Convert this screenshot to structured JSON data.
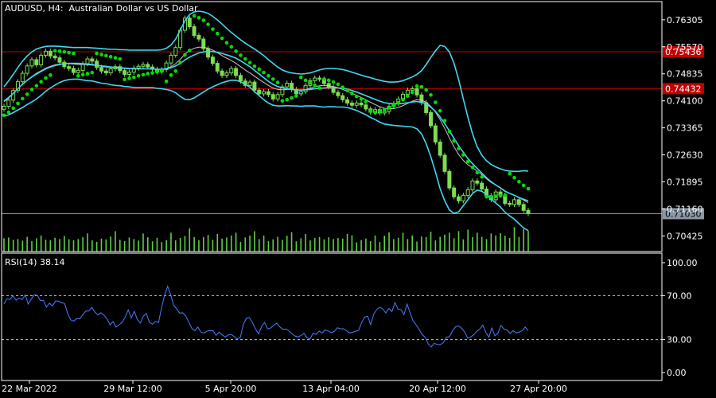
{
  "header": {
    "symbol_title": "AUDUSD, H4:  Australian Dollar vs US Dollar"
  },
  "rsi_panel": {
    "title": "RSI(14) 38.14"
  },
  "colors": {
    "background": "#000000",
    "candle": "#7fdc55",
    "volume": "#5fcf45",
    "bollinger": "#40d8f0",
    "moving_average": "#c8c8c8",
    "parabolic_sar": "#00e000",
    "hline": "#c00000",
    "bid_line": "#8a98a6",
    "rsi_line": "#4a7cff",
    "axis_text": "#ffffff"
  },
  "chart_data": [
    {
      "type": "candlestick",
      "title": "AUDUSD, H4:  Australian Dollar vs US Dollar",
      "ylim": [
        0.7,
        0.768
      ],
      "y_tick_labels": [
        "0.76305",
        "0.75570",
        "0.74835",
        "0.74100",
        "0.73365",
        "0.72630",
        "0.71895",
        "0.71160",
        "0.70425"
      ],
      "y_ticks": [
        0.76305,
        0.7557,
        0.74835,
        0.741,
        0.73365,
        0.7263,
        0.71895,
        0.7116,
        0.70425
      ],
      "horizontal_levels": [
        {
          "value": 0.75436,
          "label": "0.75436",
          "color": "#c00000"
        },
        {
          "value": 0.74432,
          "label": "0.74432",
          "color": "#c00000"
        }
      ],
      "current_price": {
        "value": 0.7103,
        "label": "0.71030"
      },
      "x_labels": [
        "22 Mar 2022",
        "29 Mar 12:00",
        "5 Apr 20:00",
        "13 Apr 04:00",
        "20 Apr 12:00",
        "27 Apr 20:00"
      ],
      "close": [
        0.7395,
        0.7412,
        0.7438,
        0.7462,
        0.7485,
        0.7505,
        0.7522,
        0.7508,
        0.7534,
        0.7545,
        0.7532,
        0.7527,
        0.7515,
        0.7503,
        0.7498,
        0.7487,
        0.7493,
        0.7511,
        0.7524,
        0.7518,
        0.7501,
        0.7491,
        0.7486,
        0.7497,
        0.7503,
        0.7492,
        0.7482,
        0.7488,
        0.7499,
        0.7504,
        0.7509,
        0.7502,
        0.7496,
        0.7489,
        0.7495,
        0.7513,
        0.7534,
        0.7555,
        0.7602,
        0.7635,
        0.7612,
        0.7588,
        0.7578,
        0.7552,
        0.7529,
        0.7512,
        0.7491,
        0.7479,
        0.7486,
        0.7498,
        0.7479,
        0.7464,
        0.7452,
        0.7461,
        0.7439,
        0.7429,
        0.7435,
        0.7427,
        0.7415,
        0.7427,
        0.7448,
        0.7458,
        0.7441,
        0.7429,
        0.7435,
        0.7452,
        0.7465,
        0.7472,
        0.7469,
        0.7457,
        0.7448,
        0.7433,
        0.7424,
        0.7413,
        0.7404,
        0.7398,
        0.7404,
        0.7399,
        0.7388,
        0.7379,
        0.7386,
        0.7377,
        0.7381,
        0.7395,
        0.7403,
        0.7415,
        0.7428,
        0.7439,
        0.7443,
        0.7426,
        0.7405,
        0.7378,
        0.7342,
        0.7298,
        0.7262,
        0.7218,
        0.7173,
        0.7149,
        0.7138,
        0.7153,
        0.7168,
        0.7192,
        0.7186,
        0.717,
        0.7152,
        0.7141,
        0.7162,
        0.7153,
        0.7131,
        0.7128,
        0.7141,
        0.7128,
        0.7112,
        0.7103
      ],
      "bollinger_mid": [
        0.7408,
        0.7418,
        0.743,
        0.7443,
        0.7455,
        0.7466,
        0.7475,
        0.7483,
        0.749,
        0.7497,
        0.7502,
        0.7506,
        0.7509,
        0.7511,
        0.7512,
        0.7512,
        0.7512,
        0.7511,
        0.751,
        0.7509,
        0.7507,
        0.7505,
        0.7504,
        0.7502,
        0.7501,
        0.75,
        0.7499,
        0.7498,
        0.7497,
        0.7497,
        0.7497,
        0.7497,
        0.7497,
        0.7496,
        0.7496,
        0.7497,
        0.75,
        0.7505,
        0.7512,
        0.7521,
        0.7529,
        0.7535,
        0.754,
        0.7543,
        0.7545,
        0.7544,
        0.7542,
        0.7539,
        0.7535,
        0.7531,
        0.7526,
        0.7519,
        0.7511,
        0.7503,
        0.7493,
        0.7483,
        0.7473,
        0.7463,
        0.7455,
        0.7449,
        0.7445,
        0.7443,
        0.7441,
        0.744,
        0.7439,
        0.744,
        0.7441,
        0.7443,
        0.7444,
        0.7445,
        0.7446,
        0.7446,
        0.7445,
        0.7444,
        0.7442,
        0.7438,
        0.7434,
        0.7429,
        0.7424,
        0.7419,
        0.7414,
        0.7409,
        0.7405,
        0.7403,
        0.7402,
        0.7402,
        0.7403,
        0.7405,
        0.7407,
        0.7408,
        0.7406,
        0.7401,
        0.7393,
        0.7381,
        0.7366,
        0.7348,
        0.7328,
        0.7308,
        0.7288,
        0.727,
        0.7253,
        0.7239,
        0.7226,
        0.7213,
        0.7201,
        0.719,
        0.7181,
        0.7173,
        0.7164,
        0.7158,
        0.7153,
        0.7147,
        0.7142,
        0.7138
      ],
      "bollinger_upper": [
        0.7448,
        0.7464,
        0.7482,
        0.7501,
        0.7518,
        0.7532,
        0.7543,
        0.7551,
        0.7555,
        0.7558,
        0.7559,
        0.7559,
        0.7558,
        0.7557,
        0.7556,
        0.7555,
        0.7555,
        0.7555,
        0.7555,
        0.7554,
        0.7553,
        0.7552,
        0.7551,
        0.755,
        0.755,
        0.7549,
        0.7549,
        0.7548,
        0.7548,
        0.7548,
        0.7548,
        0.7548,
        0.7548,
        0.7548,
        0.7549,
        0.7553,
        0.7562,
        0.7578,
        0.7602,
        0.7628,
        0.7645,
        0.7652,
        0.7654,
        0.7652,
        0.7648,
        0.764,
        0.763,
        0.7619,
        0.7607,
        0.7596,
        0.7586,
        0.7576,
        0.7567,
        0.7559,
        0.7551,
        0.7542,
        0.7533,
        0.7522,
        0.7512,
        0.7502,
        0.7494,
        0.7489,
        0.7486,
        0.7484,
        0.7483,
        0.7484,
        0.7486,
        0.749,
        0.7494,
        0.7497,
        0.7498,
        0.7498,
        0.7497,
        0.7495,
        0.7492,
        0.7488,
        0.7484,
        0.748,
        0.7476,
        0.7473,
        0.7469,
        0.7466,
        0.7463,
        0.7461,
        0.7461,
        0.7462,
        0.7465,
        0.747,
        0.7475,
        0.7482,
        0.7492,
        0.7509,
        0.7528,
        0.7546,
        0.7561,
        0.7558,
        0.7543,
        0.7512,
        0.7468,
        0.7415,
        0.7365,
        0.732,
        0.7285,
        0.7262,
        0.7247,
        0.7237,
        0.723,
        0.7225,
        0.7221,
        0.7219,
        0.7218,
        0.7218,
        0.722,
        0.7219
      ],
      "bollinger_lower": [
        0.7368,
        0.7372,
        0.7378,
        0.7385,
        0.7392,
        0.74,
        0.7407,
        0.7415,
        0.7425,
        0.7436,
        0.7445,
        0.7453,
        0.746,
        0.7465,
        0.7468,
        0.7469,
        0.7469,
        0.7467,
        0.7465,
        0.7464,
        0.7461,
        0.7458,
        0.7457,
        0.7454,
        0.7452,
        0.7451,
        0.7449,
        0.7448,
        0.7446,
        0.7446,
        0.7446,
        0.7446,
        0.7446,
        0.7444,
        0.7443,
        0.7441,
        0.7438,
        0.7432,
        0.7422,
        0.7414,
        0.7413,
        0.7418,
        0.7426,
        0.7434,
        0.7442,
        0.7448,
        0.7454,
        0.7459,
        0.7463,
        0.7466,
        0.7466,
        0.7462,
        0.7455,
        0.7447,
        0.7435,
        0.7424,
        0.7413,
        0.7404,
        0.7398,
        0.7396,
        0.7396,
        0.7397,
        0.7396,
        0.7396,
        0.7395,
        0.7396,
        0.7396,
        0.7396,
        0.7394,
        0.7393,
        0.7394,
        0.7394,
        0.7393,
        0.7393,
        0.7392,
        0.7388,
        0.7384,
        0.7378,
        0.7372,
        0.7365,
        0.7359,
        0.7352,
        0.7347,
        0.7345,
        0.7343,
        0.7342,
        0.7341,
        0.734,
        0.7339,
        0.7334,
        0.732,
        0.7293,
        0.7258,
        0.7216,
        0.7171,
        0.7138,
        0.7113,
        0.7104,
        0.7108,
        0.7125,
        0.7141,
        0.7158,
        0.7167,
        0.7164,
        0.7155,
        0.7143,
        0.7132,
        0.7121,
        0.7107,
        0.7097,
        0.7088,
        0.7076,
        0.7064,
        0.7057
      ],
      "moving_average": [
        0.741,
        0.742,
        0.7431,
        0.7443,
        0.7455,
        0.7466,
        0.7476,
        0.7485,
        0.7492,
        0.7499,
        0.7504,
        0.7508,
        0.751,
        0.7511,
        0.7511,
        0.751,
        0.7509,
        0.7509,
        0.7508,
        0.7507,
        0.7506,
        0.7504,
        0.7502,
        0.7501,
        0.75,
        0.7499,
        0.7498,
        0.7497,
        0.7497,
        0.7497,
        0.7497,
        0.7497,
        0.7496,
        0.7496,
        0.7496,
        0.7498,
        0.7503,
        0.7511,
        0.7523,
        0.7537,
        0.7547,
        0.7553,
        0.7556,
        0.7556,
        0.7553,
        0.7548,
        0.7541,
        0.7533,
        0.7526,
        0.752,
        0.7512,
        0.7503,
        0.7494,
        0.7486,
        0.7477,
        0.7468,
        0.746,
        0.7452,
        0.7445,
        0.7441,
        0.744,
        0.7441,
        0.7441,
        0.744,
        0.7439,
        0.7441,
        0.7444,
        0.7448,
        0.7451,
        0.7452,
        0.7451,
        0.7449,
        0.7446,
        0.7441,
        0.7436,
        0.743,
        0.7425,
        0.7419,
        0.7413,
        0.7406,
        0.74,
        0.7394,
        0.739,
        0.7388,
        0.7389,
        0.7392,
        0.7397,
        0.7403,
        0.7409,
        0.7413,
        0.7412,
        0.7406,
        0.7395,
        0.7379,
        0.7359,
        0.7335,
        0.7309,
        0.7285,
        0.7264,
        0.7248,
        0.7236,
        0.7228,
        0.7219,
        0.7209,
        0.7198,
        0.7188,
        0.7181,
        0.7174,
        0.7165,
        0.7158,
        0.7153,
        0.7147,
        0.714,
        0.7133
      ],
      "parabolic_sar": [
        0.7371,
        0.7379,
        0.739,
        0.7403,
        0.7416,
        0.7428,
        0.7441,
        0.7451,
        0.7462,
        0.7472,
        0.748,
        0.7546,
        0.7545,
        0.7543,
        0.7541,
        0.7539,
        0.7478,
        0.7481,
        0.7484,
        0.7487,
        0.7539,
        0.7536,
        0.7533,
        0.753,
        0.7527,
        0.7524,
        0.7468,
        0.7471,
        0.7474,
        0.7478,
        0.7481,
        0.7484,
        0.7486,
        0.7489,
        0.7491,
        0.7463,
        0.748,
        0.7491,
        0.7514,
        0.7535,
        0.7547,
        0.7641,
        0.7636,
        0.7629,
        0.7618,
        0.7605,
        0.7593,
        0.758,
        0.7568,
        0.7557,
        0.7545,
        0.7534,
        0.7524,
        0.7514,
        0.7504,
        0.7496,
        0.7487,
        0.7478,
        0.7469,
        0.746,
        0.741,
        0.7413,
        0.7418,
        0.7423,
        0.7474,
        0.7466,
        0.7459,
        0.7452,
        0.7445,
        0.7469,
        0.7466,
        0.7461,
        0.7455,
        0.7447,
        0.7438,
        0.743,
        0.7422,
        0.7415,
        0.7408,
        0.7382,
        0.7378,
        0.7381,
        0.7386,
        0.7391,
        0.7398,
        0.7405,
        0.7413,
        0.7423,
        0.7433,
        0.745,
        0.7448,
        0.744,
        0.7426,
        0.7406,
        0.7383,
        0.7356,
        0.7327,
        0.7301,
        0.728,
        0.7263,
        0.7245,
        0.7229,
        0.7215,
        0.7203,
        0.7149,
        0.7149,
        0.715,
        0.7152,
        0.7153,
        0.7212,
        0.7201,
        0.719,
        0.718,
        0.7171
      ],
      "volume": [
        0.52,
        0.55,
        0.46,
        0.49,
        0.43,
        0.58,
        0.41,
        0.52,
        0.63,
        0.47,
        0.45,
        0.54,
        0.49,
        0.61,
        0.48,
        0.45,
        0.49,
        0.56,
        0.71,
        0.44,
        0.38,
        0.51,
        0.48,
        0.59,
        0.8,
        0.46,
        0.41,
        0.55,
        0.49,
        0.43,
        0.71,
        0.56,
        0.4,
        0.54,
        0.37,
        0.45,
        0.74,
        0.44,
        0.53,
        0.61,
        0.91,
        0.57,
        0.45,
        0.57,
        0.65,
        0.46,
        0.69,
        0.51,
        0.55,
        0.63,
        0.74,
        0.38,
        0.55,
        0.63,
        0.8,
        0.49,
        0.63,
        0.41,
        0.48,
        0.58,
        0.46,
        0.62,
        0.76,
        0.4,
        0.52,
        0.69,
        0.44,
        0.53,
        0.57,
        0.48,
        0.56,
        0.49,
        0.53,
        0.51,
        0.69,
        0.64,
        0.36,
        0.45,
        0.51,
        0.41,
        0.63,
        0.37,
        0.62,
        0.75,
        0.49,
        0.54,
        0.74,
        0.49,
        0.63,
        0.39,
        0.59,
        0.57,
        0.78,
        0.44,
        0.58,
        0.66,
        0.74,
        0.52,
        0.8,
        0.48,
        0.86,
        0.57,
        0.74,
        0.58,
        0.49,
        0.71,
        0.63,
        0.72,
        0.62,
        0.53,
        0.96,
        0.57,
        0.88,
        0.81
      ]
    },
    {
      "type": "line",
      "title": "RSI(14) 38.14",
      "ylim": [
        0,
        100
      ],
      "y_tick_labels": [
        "100.00",
        "70.00",
        "30.00",
        "0.00"
      ],
      "y_ticks": [
        100,
        70,
        30,
        0
      ],
      "levels": [
        70,
        30
      ],
      "x_labels": [
        "22 Mar 2022",
        "29 Mar 12:00",
        "5 Apr 20:00",
        "13 Apr 04:00",
        "20 Apr 12:00",
        "27 Apr 20:00"
      ],
      "values": [
        62.5,
        67.1,
        66.5,
        70.0,
        65.8,
        67.7,
        66.3,
        70.7,
        62.4,
        66.9,
        70.8,
        70.3,
        65.6,
        65.7,
        59.6,
        63.2,
        60.6,
        65.2,
        65.0,
        63.5,
        62.8,
        54.0,
        48.0,
        46.8,
        49.1,
        48.9,
        52.6,
        55.9,
        56.1,
        59.3,
        55.1,
        52.4,
        54.5,
        52.1,
        48.9,
        43.4,
        46.4,
        41.3,
        43.5,
        45.8,
        50.6,
        57.1,
        49.8,
        55.9,
        48.4,
        45.0,
        51.4,
        53.7,
        45.7,
        43.9,
        46.5,
        45.6,
        59.3,
        70.3,
        78.5,
        70.9,
        61.2,
        57.8,
        54.1,
        54.4,
        51.2,
        45.9,
        40.0,
        38.1,
        41.3,
        36.8,
        35.9,
        37.6,
        38.2,
        38.0,
        33.9,
        36.9,
        34.3,
        32.4,
        34.2,
        34.8,
        32.5,
        30.6,
        32.2,
        43.8,
        49.5,
        50.1,
        45.4,
        39.6,
        35.2,
        41.9,
        45.6,
        39.7,
        40.6,
        42.9,
        45.0,
        41.6,
        39.3,
        39.6,
        38.0,
        35.3,
        33.3,
        32.3,
        33.7,
        35.8,
        31.7,
        30.4,
        35.8,
        34.7,
        37.8,
        35.9,
        38.8,
        37.8,
        36.3,
        37.4,
        40.8,
        39.8,
        39.9,
        38.1,
        36.1,
        36.7,
        37.6,
        38.2,
        45.3,
        50.4,
        51.4,
        43.5,
        53.0,
        57.3,
        59.6,
        57.8,
        54.1,
        58.3,
        55.4,
        63.6,
        57.8,
        57.3,
        52.7,
        62.4,
        54.7,
        47.0,
        43.3,
        39.1,
        34.4,
        32.2,
        26.0,
        23.3,
        26.6,
        25.5,
        25.4,
        27.2,
        32.2,
        32.6,
        37.9,
        41.6,
        42.5,
        40.3,
        37.0,
        31.3,
        32.3,
        34.3,
        37.5,
        39.6,
        43.2,
        36.6,
        32.2,
        40.5,
        33.4,
        35.8,
        42.9,
        39.5,
        38.8,
        35.5,
        38.1,
        36.0,
        36.8,
        38.1,
        41.4,
        38.14
      ]
    }
  ]
}
